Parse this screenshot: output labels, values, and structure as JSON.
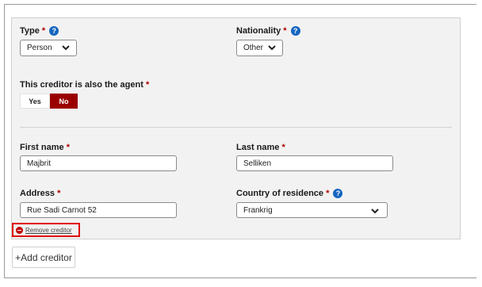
{
  "required_mark": "*",
  "help_icon": "question-circle-icon",
  "type": {
    "label": "Type",
    "value": "Person"
  },
  "nationality": {
    "label": "Nationality",
    "value": "Other"
  },
  "agent": {
    "label": "This creditor is also the agent",
    "yes_label": "Yes",
    "no_label": "No",
    "selected": "No"
  },
  "first_name": {
    "label": "First name",
    "value": "Majbrit"
  },
  "last_name": {
    "label": "Last name",
    "value": "Selliken"
  },
  "address": {
    "label": "Address",
    "value": "Rue Sadi Carnot 52"
  },
  "country": {
    "label": "Country of residence",
    "value": "Frankrig"
  },
  "remove_label": "Remove creditor",
  "add_label": "+Add creditor",
  "colors": {
    "accent": "#9b0000",
    "help": "#1565c0",
    "highlight_border": "#e00000"
  }
}
